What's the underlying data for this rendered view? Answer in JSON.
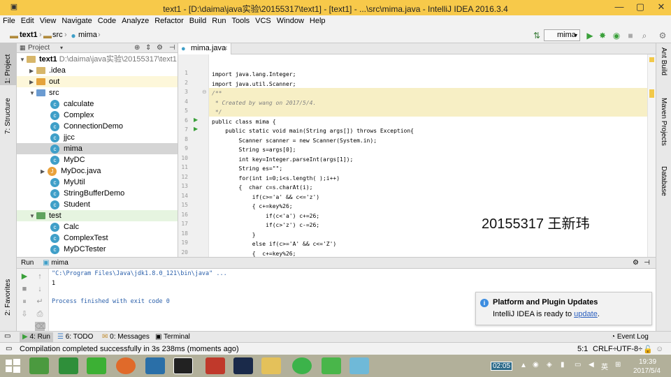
{
  "window": {
    "title": "text1 - [D:\\daima\\java实验\\20155317\\text1] - [text1] - ...\\src\\mima.java - IntelliJ IDEA 2016.3.4",
    "minimize": "—",
    "maximize": "▢",
    "close": "✕"
  },
  "menu": [
    "File",
    "Edit",
    "View",
    "Navigate",
    "Code",
    "Analyze",
    "Refactor",
    "Build",
    "Run",
    "Tools",
    "VCS",
    "Window",
    "Help"
  ],
  "breadcrumbs": [
    "text1",
    "src",
    "mima"
  ],
  "run_config": "mima",
  "project_panel": {
    "header": "Project",
    "root": "text1",
    "root_path": "D:\\daima\\java实验\\20155317\\text1",
    "items": [
      {
        "label": ".idea",
        "kind": "folder"
      },
      {
        "label": "out",
        "kind": "folder"
      },
      {
        "label": "src",
        "kind": "folder"
      },
      {
        "label": "calculate",
        "kind": "class"
      },
      {
        "label": "Complex",
        "kind": "class"
      },
      {
        "label": "ConnectionDemo",
        "kind": "class"
      },
      {
        "label": "jjcc",
        "kind": "class"
      },
      {
        "label": "mima",
        "kind": "class"
      },
      {
        "label": "MyDC",
        "kind": "class"
      },
      {
        "label": "MyDoc.java",
        "kind": "file"
      },
      {
        "label": "MyUtil",
        "kind": "class"
      },
      {
        "label": "StringBufferDemo",
        "kind": "class"
      },
      {
        "label": "Student",
        "kind": "class"
      },
      {
        "label": "test",
        "kind": "folder"
      },
      {
        "label": "Calc",
        "kind": "class"
      },
      {
        "label": "ComplexTest",
        "kind": "class"
      },
      {
        "label": "MyDCTester",
        "kind": "class"
      }
    ]
  },
  "left_tabs": [
    "1: Project",
    "7: Structure",
    "2: Favorites"
  ],
  "right_tabs": [
    "Ant Build",
    "Maven Projects",
    "Database"
  ],
  "editor": {
    "tab": "mima.java",
    "line_numbers": [
      "1",
      "2",
      "3",
      "4",
      "5",
      "6",
      "7",
      "8",
      "9",
      "10",
      "11",
      "12",
      "13",
      "14",
      "15",
      "16",
      "17",
      "18",
      "19",
      "20"
    ],
    "lines": [
      "import java.lang.Integer;",
      "import java.util.Scanner;",
      "/**",
      " * Created by wang on 2017/5/4.",
      " */",
      "public class mima {",
      "    public static void main(String args[]) throws Exception{",
      "        Scanner scanner = new Scanner(System.in);",
      "        String s=args[0];",
      "        int key=Integer.parseInt(args[1]);",
      "        String es=\"\";",
      "        for(int i=0;i<s.length( );i++)",
      "        {  char c=s.charAt(i);",
      "            if(c>='a' && c<='z')",
      "            { c+=key%26;",
      "                if(c<'a') c+=26;",
      "                if(c>'z') c-=26;",
      "            }",
      "            else if(c>='A' && c<='Z')",
      "            {  c+=key%26;"
    ],
    "overlay_text": "20155317 王新玮"
  },
  "run_panel": {
    "label": "Run",
    "config": "mima",
    "output": [
      "\"C:\\Program Files\\Java\\jdk1.8.0_121\\bin\\java\" ...",
      "1",
      "",
      "Process finished with exit code 0"
    ]
  },
  "notification": {
    "title": "Platform and Plugin Updates",
    "body": "IntelliJ IDEA is ready to",
    "link": "update",
    "end": "."
  },
  "bottom_tools": [
    "4: Run",
    "6: TODO",
    "0: Messages",
    "Terminal",
    "Event Log"
  ],
  "status": {
    "message": "Compilation completed successfully in 3s 238ms (moments ago)",
    "position": "5:1",
    "line_sep": "CRLF÷",
    "encoding": "UTF-8÷"
  },
  "taskbar": {
    "clock_badge": "02:05",
    "time": "19:39",
    "date": "2017/5/4",
    "ime": "英"
  }
}
